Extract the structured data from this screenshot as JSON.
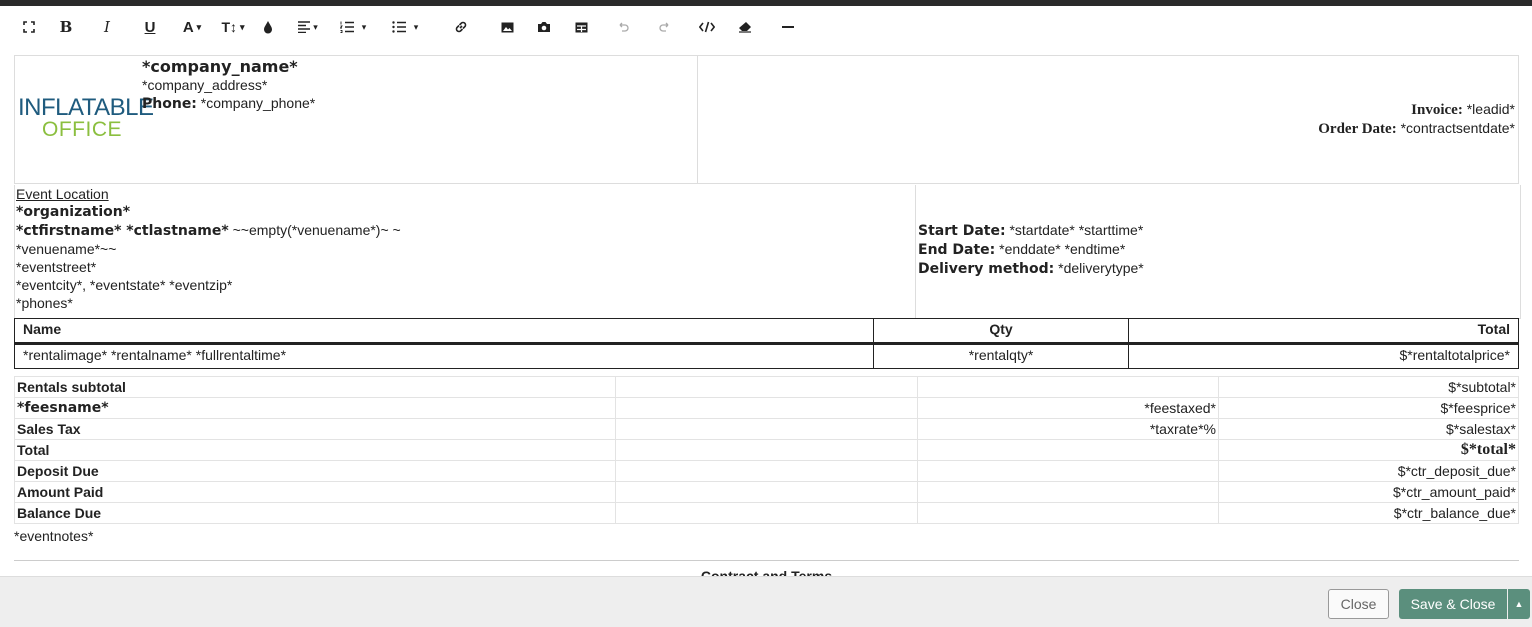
{
  "toolbar": {
    "font_size_label": "T↕",
    "caret": "▾"
  },
  "header": {
    "logo_line1": "INFLATABLE",
    "logo_line2": "OFFICE",
    "company_name": "*company_name*",
    "company_address": "*company_address*",
    "phone_label": "Phone:",
    "phone_value": "*company_phone*",
    "invoice_label": "Invoice:",
    "invoice_value": "*leadid*",
    "order_date_label": "Order Date:",
    "order_date_value": "*contractsentdate*"
  },
  "event": {
    "location_title": "Event Location",
    "organization": "*organization*",
    "name_bold": "*ctfirstname* *ctlastname*",
    "name_rest": "~~empty(*venuename*)~ ~",
    "venue": "*venuename*~~",
    "street": "*eventstreet*",
    "city_line": "*eventcity*, *eventstate* *eventzip*",
    "phones": "*phones*",
    "start_label": "Start Date:",
    "start_value": "*startdate* *starttime*",
    "end_label": "End Date:",
    "end_value": "*enddate* *endtime*",
    "delivery_label": "Delivery method:",
    "delivery_value": "*deliverytype*"
  },
  "items": {
    "col_name": "Name",
    "col_qty": "Qty",
    "col_total": "Total",
    "row_name": "*rentalimage* *rentalname* *fullrentaltime*",
    "row_qty": "*rentalqty*",
    "row_total": "$*rentaltotalprice*"
  },
  "summary": {
    "subtotal_label": "Rentals subtotal",
    "subtotal_value": "$*subtotal*",
    "fees_label": "*feesname*",
    "fees_taxed": "*feestaxed*",
    "fees_value": "$*feesprice*",
    "tax_label": "Sales Tax",
    "tax_rate": "*taxrate*%",
    "tax_value": "$*salestax*",
    "total_label": "Total",
    "total_value": "$*total*",
    "deposit_label": "Deposit Due",
    "deposit_value": "$*ctr_deposit_due*",
    "paid_label": "Amount Paid",
    "paid_value": "$*ctr_amount_paid*",
    "balance_label": "Balance Due",
    "balance_value": "$*ctr_balance_due*"
  },
  "notes": "*eventnotes*",
  "contract_title": "Contract and Terms",
  "footer": {
    "close_label": "Close",
    "save_label": "Save & Close",
    "split_caret": "▲"
  }
}
